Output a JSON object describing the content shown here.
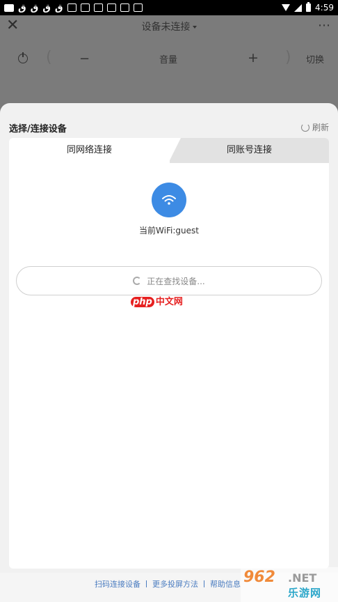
{
  "status_bar": {
    "time": "4:59",
    "left_icons": [
      "message-icon",
      "q-app-icon",
      "q-app-icon",
      "q-app-icon",
      "q-app-icon",
      "square-icon",
      "square-icon",
      "square-icon",
      "square-icon",
      "square-icon",
      "square-icon"
    ],
    "q_letter": "ق"
  },
  "header": {
    "title": "设备未连接",
    "volume_label": "音量",
    "minus": "−",
    "plus": "+",
    "switch_label": "切换",
    "close_glyph": "✕",
    "more_glyph": "⋯"
  },
  "sheet": {
    "title": "选择/连接设备",
    "refresh_label": "刷新",
    "tabs": [
      {
        "label": "同网络连接",
        "active": true
      },
      {
        "label": "同账号连接",
        "active": false
      }
    ],
    "wifi_status": "当前WiFi:guest",
    "searching_text": "正在查找设备..."
  },
  "footer": {
    "links": [
      "扫码连接设备",
      "更多投屏方法",
      "帮助信息"
    ]
  },
  "watermarks": {
    "php_a": "php",
    "php_b": "中文网",
    "site_num": "962",
    "site_net": ".NET",
    "site_sub": "乐游网"
  },
  "colors": {
    "accent_blue": "#3d8be4",
    "link_blue": "#4a7cc0"
  }
}
